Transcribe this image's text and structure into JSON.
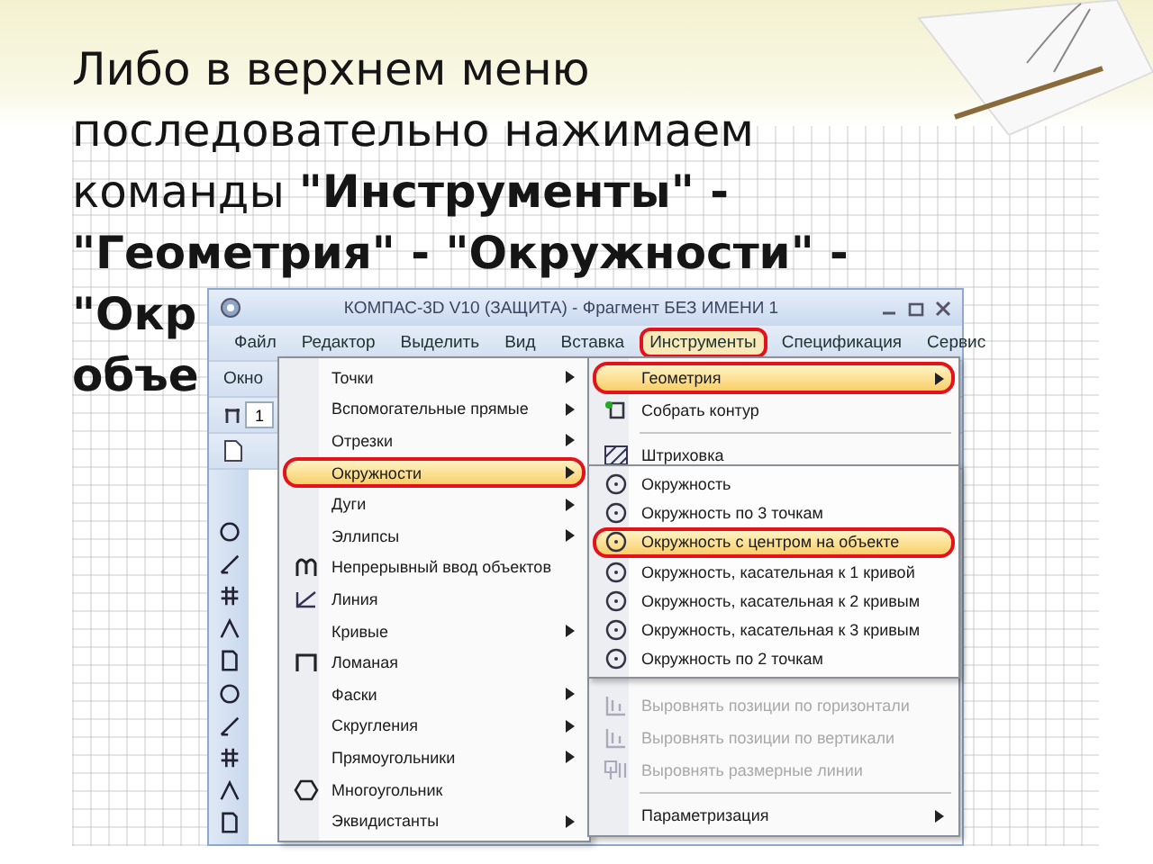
{
  "slide": {
    "text": "Либо в верхнем меню последовательно нажимаем команды **\"Инструменты\" - \"Геометрия\" - \"Окружности\" -**",
    "cut_lines": [
      "\"Окр",
      "объе"
    ]
  },
  "window": {
    "title": "КОМПАС-3D V10 (ЗАЩИТА) - Фрагмент БЕЗ ИМЕНИ 1",
    "menu_bar": [
      {
        "label": "Файл",
        "selected": false,
        "circled": false
      },
      {
        "label": "Редактор",
        "selected": false,
        "circled": false
      },
      {
        "label": "Выделить",
        "selected": false,
        "circled": false
      },
      {
        "label": "Вид",
        "selected": false,
        "circled": false
      },
      {
        "label": "Вставка",
        "selected": false,
        "circled": false
      },
      {
        "label": "Инструменты",
        "selected": true,
        "circled": true
      },
      {
        "label": "Спецификация",
        "selected": false,
        "circled": false
      },
      {
        "label": "Сервис",
        "selected": false,
        "circled": false
      }
    ],
    "menu_bar_row_2": [
      {
        "label": "Окно",
        "selected": false,
        "circled": false
      }
    ],
    "toolbar_field": {
      "value": "1"
    },
    "main_menu": [
      {
        "label": "Точки",
        "kind": "submenu",
        "selected": false,
        "circled": false
      },
      {
        "label": "Вспомогательные прямые",
        "kind": "submenu",
        "selected": false,
        "circled": false
      },
      {
        "label": "Отрезки",
        "kind": "submenu",
        "selected": false,
        "circled": false
      },
      {
        "label": "Окружности",
        "kind": "submenu",
        "selected": true,
        "circled": true
      },
      {
        "label": "Дуги",
        "kind": "submenu",
        "selected": false,
        "circled": false
      },
      {
        "label": "Эллипсы",
        "kind": "submenu",
        "selected": false,
        "circled": false
      },
      {
        "label": "Непрерывный ввод объектов",
        "kind": "command",
        "selected": false,
        "circled": false
      },
      {
        "label": "Линия",
        "kind": "command",
        "selected": false,
        "circled": false
      },
      {
        "label": "Кривые",
        "kind": "submenu",
        "selected": false,
        "circled": false
      },
      {
        "label": "Ломаная",
        "kind": "command",
        "selected": false,
        "circled": false
      },
      {
        "label": "Фаски",
        "kind": "submenu",
        "selected": false,
        "circled": false
      },
      {
        "label": "Скругления",
        "kind": "submenu",
        "selected": false,
        "circled": false
      },
      {
        "label": "Прямоугольники",
        "kind": "submenu",
        "selected": false,
        "circled": false
      },
      {
        "label": "Многоугольник",
        "kind": "command",
        "selected": false,
        "circled": false
      },
      {
        "label": "Эквидистанты",
        "kind": "submenu",
        "selected": false,
        "circled": false
      }
    ],
    "tools_menu_top": [
      {
        "label": "Геометрия",
        "kind": "submenu",
        "selected": true,
        "circled": true,
        "disabled": false
      },
      {
        "label": "Собрать контур",
        "kind": "command",
        "selected": false,
        "circled": false,
        "disabled": false
      },
      {
        "label": "Штриховка",
        "kind": "command",
        "selected": false,
        "circled": false,
        "disabled": false
      }
    ],
    "circles_menu": [
      {
        "label": "Окружность",
        "selected": false,
        "circled": false
      },
      {
        "label": "Окружность по 3 точкам",
        "selected": false,
        "circled": false
      },
      {
        "label": "Окружность с центром на объекте",
        "selected": true,
        "circled": true
      },
      {
        "label": "Окружность, касательная к 1 кривой",
        "selected": false,
        "circled": false
      },
      {
        "label": "Окружность, касательная к 2 кривым",
        "selected": false,
        "circled": false
      },
      {
        "label": "Окружность, касательная к 3 кривым",
        "selected": false,
        "circled": false
      },
      {
        "label": "Окружность по 2 точкам",
        "selected": false,
        "circled": false
      }
    ],
    "tools_menu_bottom": [
      {
        "label": "Выровнять позиции по горизонтали",
        "kind": "command",
        "selected": false,
        "circled": false,
        "disabled": true
      },
      {
        "label": "Выровнять позиции по вертикали",
        "kind": "command",
        "selected": false,
        "circled": false,
        "disabled": true
      },
      {
        "label": "Выровнять размерные линии",
        "kind": "command",
        "selected": false,
        "circled": false,
        "disabled": true
      },
      {
        "label": "Параметризация",
        "kind": "submenu",
        "selected": false,
        "circled": false,
        "disabled": false,
        "separator_before": true
      }
    ]
  }
}
